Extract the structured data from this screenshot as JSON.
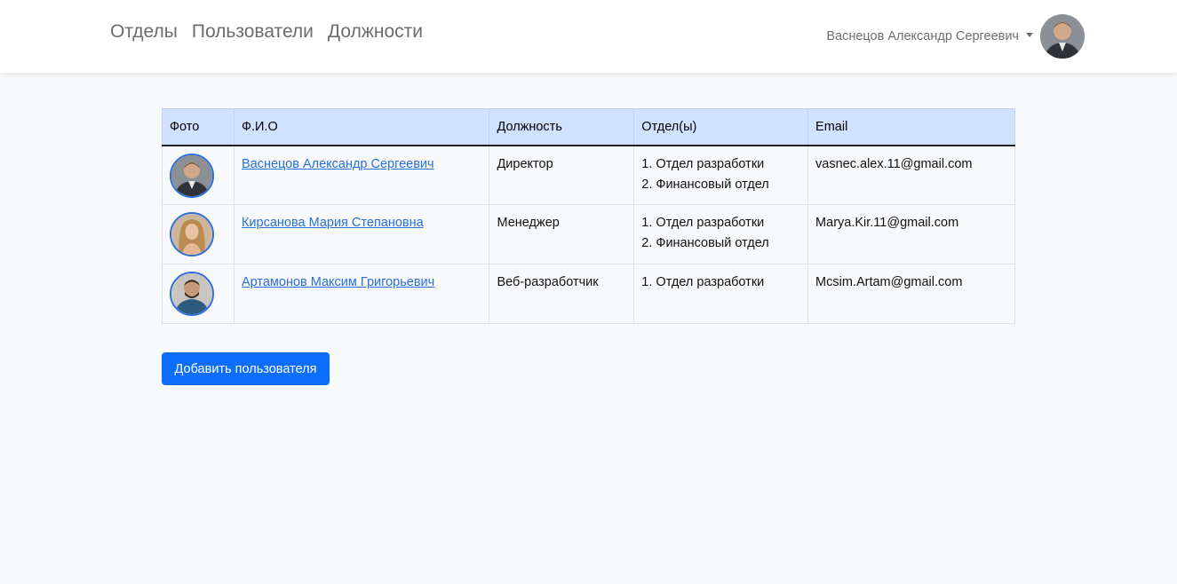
{
  "nav": {
    "links": [
      "Отделы",
      "Пользователи",
      "Должности"
    ],
    "user_name": "Васнецов Александр Сергеевич"
  },
  "table": {
    "headers": [
      "Фото",
      "Ф.И.О",
      "Должность",
      "Отдел(ы)",
      "Email"
    ],
    "rows": [
      {
        "name": "Васнецов Александр Сергеевич",
        "position": "Директор",
        "departments": [
          "1. Отдел разработки",
          "2. Финансовый отдел"
        ],
        "email": "vasnec.alex.11@gmail.com"
      },
      {
        "name": "Кирсанова Мария Степановна",
        "position": "Менеджер",
        "departments": [
          "1. Отдел разработки",
          "2. Финансовый отдел"
        ],
        "email": "Marya.Kir.11@gmail.com"
      },
      {
        "name": "Артамонов Максим Григорьевич",
        "position": "Веб-разработчик",
        "departments": [
          "1. Отдел разработки"
        ],
        "email": "Mcsim.Artam@gmail.com"
      }
    ]
  },
  "add_button_label": "Добавить пользователя",
  "colors": {
    "accent": "#0d6efd",
    "header_bg": "#cfe2ff",
    "link": "#2a6fd9"
  },
  "icons": [
    "avatar-photo",
    "caret-down-icon"
  ]
}
